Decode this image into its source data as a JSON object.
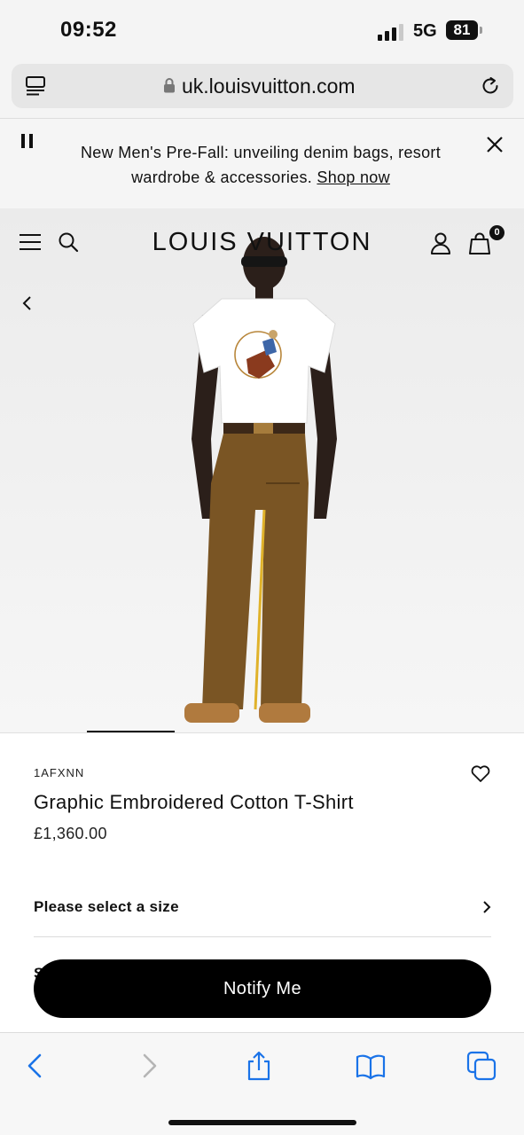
{
  "status_bar": {
    "time": "09:52",
    "network": "5G",
    "battery": "81"
  },
  "browser": {
    "url": "uk.louisvuitton.com"
  },
  "banner": {
    "message": "New Men's Pre-Fall: unveiling denim bags, resort wardrobe & accessories.",
    "link_label": "Shop now"
  },
  "header": {
    "brand": "LOUIS VUITTON",
    "bag_count": "0"
  },
  "product": {
    "sku": "1AFXNN",
    "name": "Graphic Embroidered Cotton T-Shirt",
    "price": "£1,360.00",
    "size_prompt": "Please select a size",
    "hidden_row_initial": "S",
    "cta_label": "Notify Me"
  },
  "icons": [
    "reader-icon",
    "lock-icon",
    "reload-icon",
    "pause-icon",
    "close-icon",
    "menu-icon",
    "search-icon",
    "account-icon",
    "bag-icon",
    "chevron-left-icon",
    "heart-icon",
    "chevron-right-icon",
    "back-icon",
    "forward-icon",
    "share-icon",
    "bookmarks-icon",
    "tabs-icon"
  ],
  "colors": {
    "accent": "#1a73e8",
    "cta_background": "#000000",
    "text": "#111111"
  }
}
